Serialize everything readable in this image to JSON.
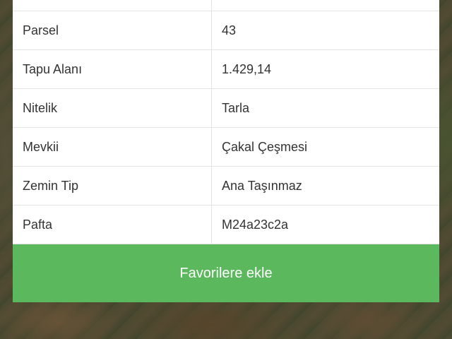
{
  "rows": [
    {
      "label": "",
      "value": ""
    },
    {
      "label": "Parsel",
      "value": "43"
    },
    {
      "label": "Tapu Alanı",
      "value": "1.429,14"
    },
    {
      "label": "Nitelik",
      "value": "Tarla"
    },
    {
      "label": "Mevkii",
      "value": "Çakal Çeşmesi"
    },
    {
      "label": "Zemin Tip",
      "value": "Ana Taşınmaz"
    },
    {
      "label": "Pafta",
      "value": "M24a23c2a"
    }
  ],
  "actions": {
    "favorite_label": "Favorilere ekle"
  },
  "colors": {
    "button": "#5cb85c",
    "button_text": "#ffffff"
  }
}
